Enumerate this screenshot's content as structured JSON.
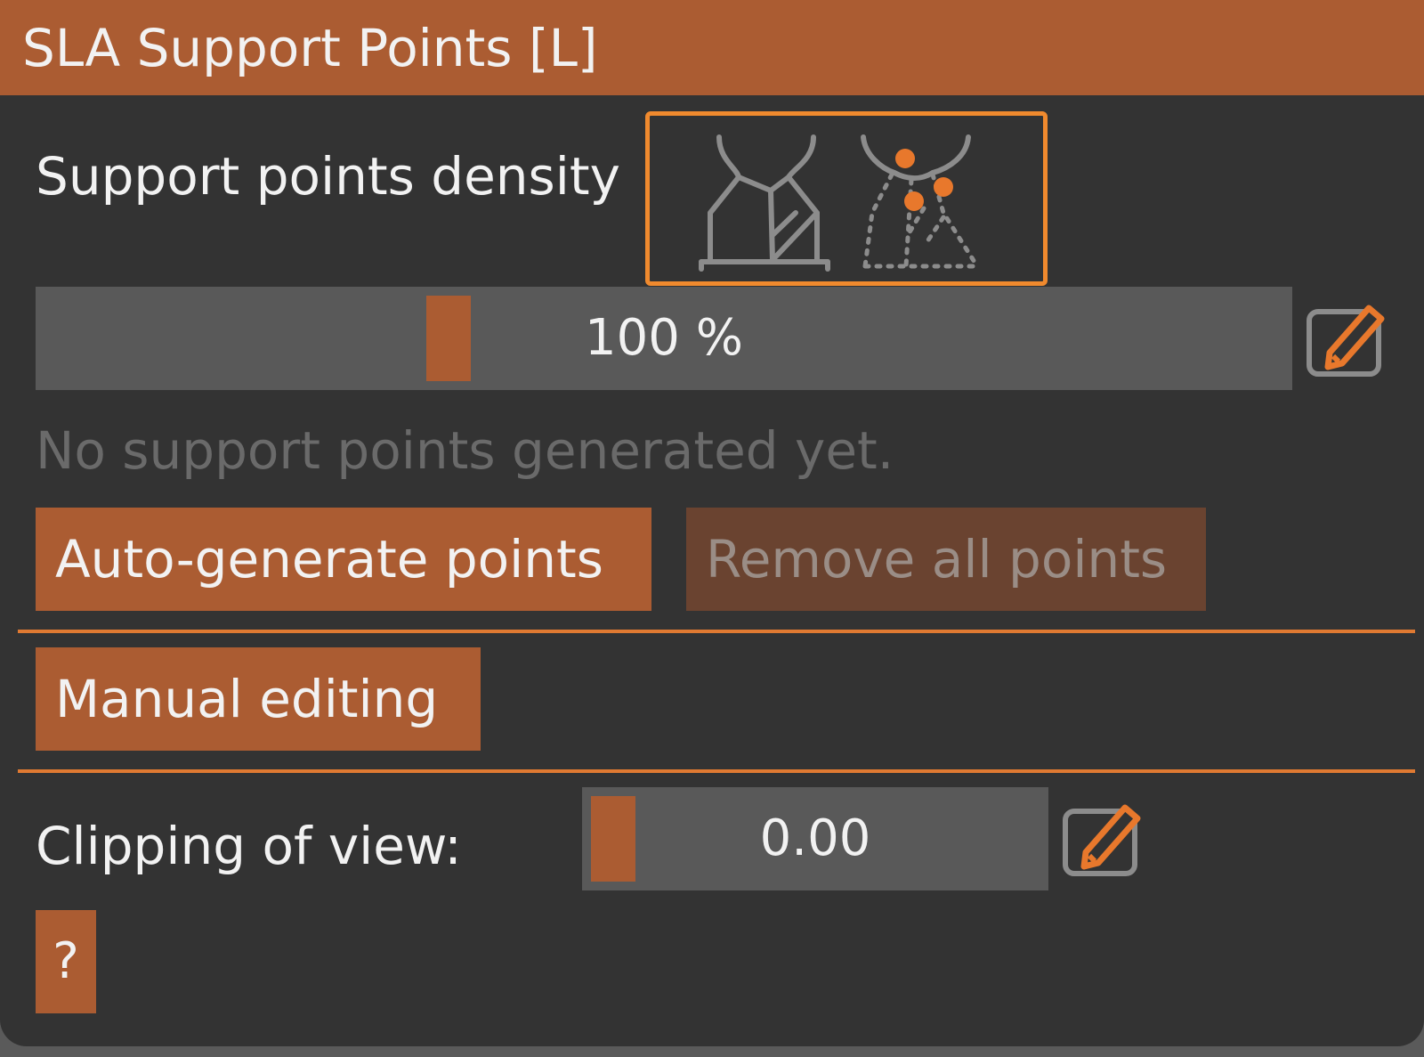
{
  "panel": {
    "title": "SLA Support Points [L]"
  },
  "density": {
    "label": "Support points density",
    "icons": [
      "support-density-low-icon",
      "support-density-high-icon"
    ],
    "slider_value": "100 %",
    "slider_fraction": 0.32
  },
  "status": {
    "message": "No support points generated yet."
  },
  "buttons": {
    "auto_generate": "Auto-generate points",
    "remove_all": "Remove all points",
    "manual_editing": "Manual editing",
    "help": "?"
  },
  "clipping": {
    "label": "Clipping of view:",
    "slider_value": "0.00",
    "slider_fraction": 0.0
  },
  "colors": {
    "accent": "#ab5c32",
    "highlight": "#f08a2e",
    "background": "#333333",
    "slider_track": "#595959"
  }
}
